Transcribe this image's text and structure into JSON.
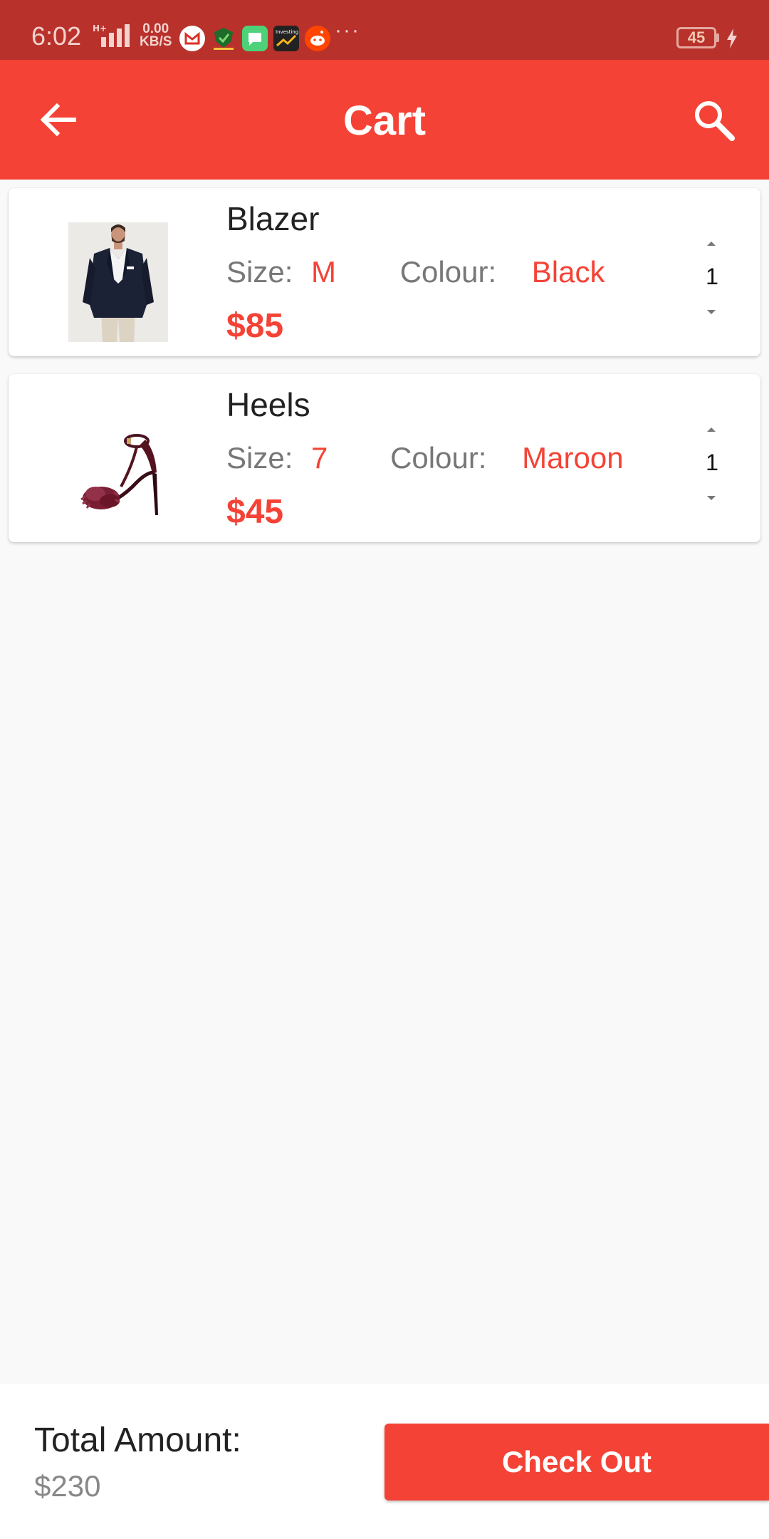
{
  "status_bar": {
    "time": "6:02",
    "speed_top": "0.00",
    "speed_bottom": "KB/S",
    "more": "···",
    "battery": "45",
    "icons": [
      "gmail-icon",
      "vpn-shield-icon",
      "messages-icon",
      "investing-icon",
      "reddit-icon"
    ]
  },
  "header": {
    "title": "Cart"
  },
  "cart": {
    "size_label": "Size:",
    "colour_label": "Colour:",
    "items": [
      {
        "name": "Blazer",
        "size": "M",
        "colour": "Black",
        "price": "$85",
        "quantity": "1"
      },
      {
        "name": "Heels",
        "size": "7",
        "colour": "Maroon",
        "price": "$45",
        "quantity": "1"
      }
    ]
  },
  "footer": {
    "total_label": "Total Amount:",
    "total_value": "$230",
    "checkout_label": "Check Out"
  },
  "colors": {
    "primary": "#f44336",
    "status_bar": "#b9312b",
    "background": "#f9f9f9"
  }
}
